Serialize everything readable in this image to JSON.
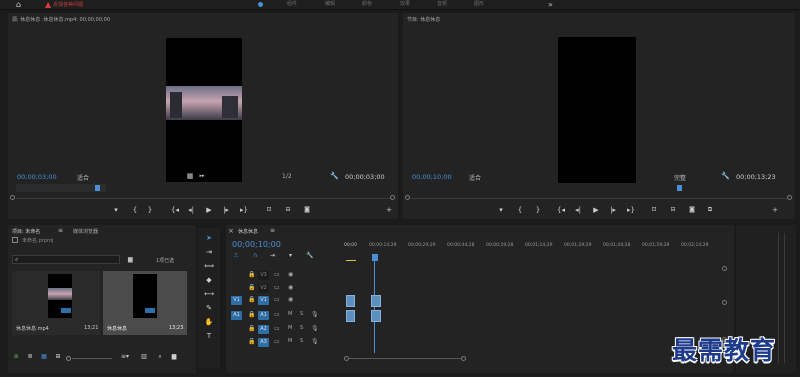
{
  "topbar": {
    "warning": "反馈各种问题",
    "workspace_tabs": [
      "组件",
      "编辑",
      "颜色",
      "效果",
      "音频",
      "图形"
    ]
  },
  "source": {
    "title": "源: 休息休息 .休息休息.mp4: 00;00;00;00",
    "timecode": "00;00;03;00",
    "fit": "适合",
    "ratio": "1/2",
    "duration": "00;00;03;00"
  },
  "program": {
    "title": "节目: 休息休息",
    "timecode": "00;00;10;00",
    "fit": "适合",
    "quality": "完整",
    "duration": "00;00;13;23"
  },
  "project": {
    "tab_project": "项目: 未命名",
    "tab_media": "媒体浏览器",
    "file_name": "未命名.prproj",
    "item_count": "1项已选",
    "items": [
      {
        "name": "休息休息.mp4",
        "duration": "13;21"
      },
      {
        "name": "休息休息",
        "duration": "13;23"
      }
    ]
  },
  "timeline": {
    "tab": "休息休息",
    "timecode": "00;00;10;00",
    "ruler": [
      "00;00",
      "00;00;14;29",
      "00;00;29;29",
      "00;00;44;28",
      "00;00;59;28",
      "00;01;14;29",
      "00;01;29;29",
      "00;01;44;28",
      "00;01;59;28",
      "00;02;14;29"
    ],
    "tracks": [
      "V3",
      "V2",
      "V1",
      "A1",
      "A2",
      "A3"
    ]
  },
  "watermark": "最需教育",
  "colors": {
    "accent": "#4a8fd6",
    "track_on": "#2d6fa8",
    "warn": "#d93b3b",
    "watermark": "#1e3a8a"
  },
  "icons": {
    "home": "home-icon",
    "warning": "warning-icon",
    "more": "chevron-double-right-icon",
    "wrench": "wrench-icon",
    "play": "play-icon",
    "camera": "camera-icon",
    "plus": "plus-icon",
    "search": "search-icon",
    "folder": "folder-icon",
    "lock": "lock-icon",
    "eye": "eye-icon",
    "mic": "mic-icon"
  }
}
